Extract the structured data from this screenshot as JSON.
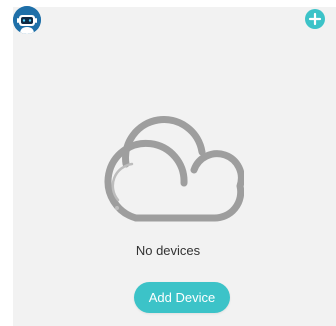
{
  "header": {
    "avatar_icon": "robot-avatar-icon",
    "add_icon": "plus-icon"
  },
  "main": {
    "empty_icon": "cloud-icon",
    "empty_text": "No devices",
    "add_button_label": "Add Device"
  },
  "colors": {
    "accent": "#3cc3c8",
    "background": "#f2f2f2",
    "avatar": "#1e6fa8",
    "cloud_stroke": "#9e9e9e"
  }
}
